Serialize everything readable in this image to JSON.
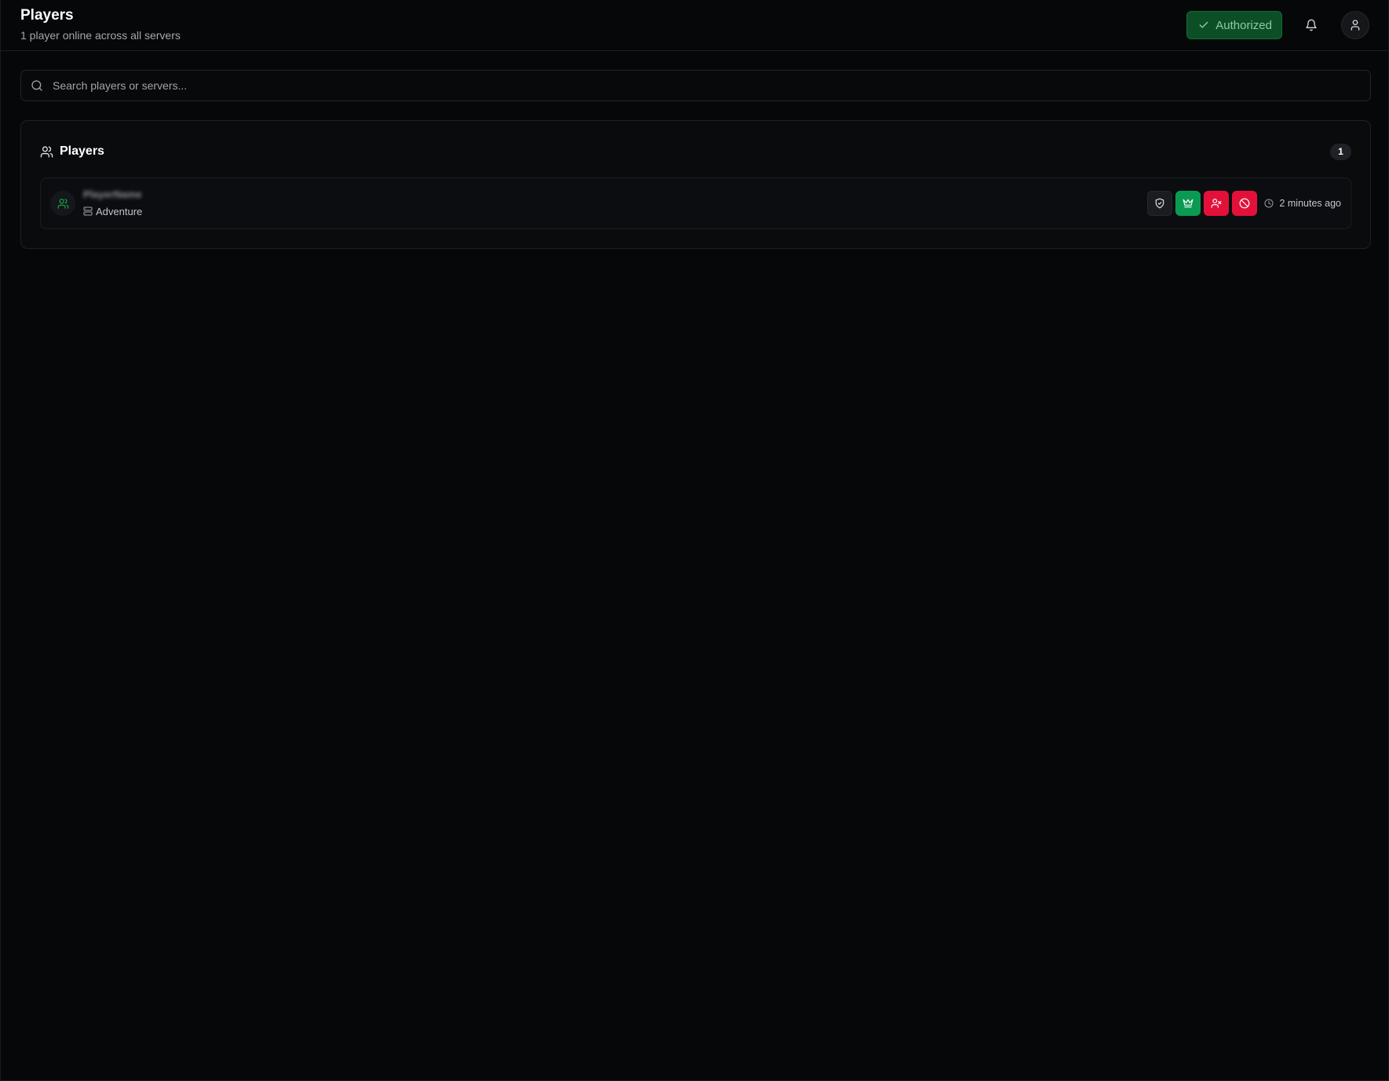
{
  "header": {
    "title": "Players",
    "subtitle": "1 player online across all servers",
    "auth_label": "Authorized",
    "icons": [
      "check-icon",
      "bell-icon",
      "user-icon"
    ]
  },
  "search": {
    "placeholder": "Search players or servers...",
    "value": ""
  },
  "players_card": {
    "title": "Players",
    "count": "1",
    "icon": "users-icon"
  },
  "players": [
    {
      "name": "PlayerName",
      "server": "Adventure",
      "last_seen": "2 minutes ago",
      "actions": [
        "shield-icon",
        "crown-icon",
        "user-x-icon",
        "ban-icon"
      ]
    }
  ],
  "colors": {
    "background": "#060709",
    "auth_green": "#0c4f26",
    "op_green": "#0b9a52",
    "danger_red": "#e3113a",
    "online_green": "#16a34a"
  }
}
